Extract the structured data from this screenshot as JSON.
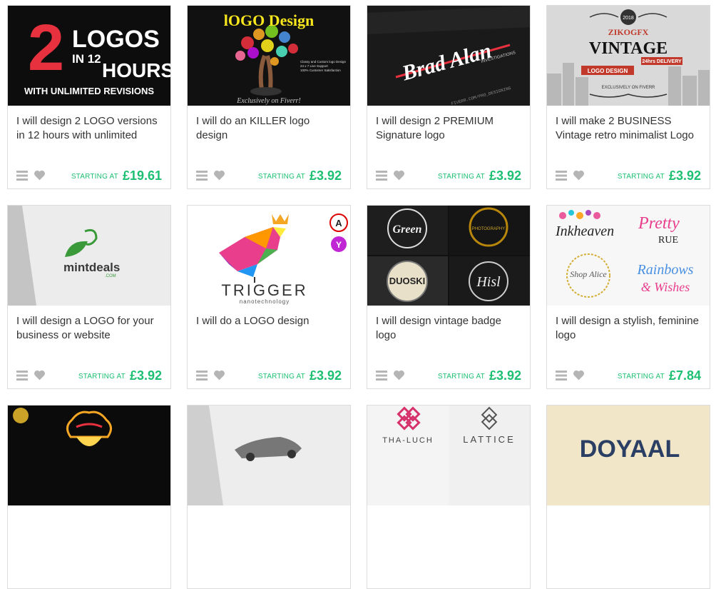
{
  "gigs": [
    {
      "title": "I will design 2 LOGO versions in 12 hours with unlimited",
      "starting": "STARTING AT",
      "price": "£19.61",
      "image": {
        "line1": "2",
        "line2": "LOGOS",
        "line3": "IN 12",
        "line4": "HOURS",
        "line5": "WITH UNLIMITED REVISIONS"
      }
    },
    {
      "title": "I will do an KILLER logo design",
      "starting": "STARTING AT",
      "price": "£3.92",
      "image": {
        "line1": "lOGO Design",
        "line2": "Exclusively on Fiverr!",
        "line3": "Classy and Custom logo Design",
        "line4": "24 x 7 Live Support",
        "line5": "100% Customer Satisfaction"
      }
    },
    {
      "title": "I will design 2 PREMIUM Signature logo",
      "starting": "STARTING AT",
      "price": "£3.92",
      "image": {
        "line1": "Brad Alan",
        "line2": "INVESTIGATIONS",
        "line3": "FIVERR.COM/PRO_DESIGNING"
      }
    },
    {
      "title": "I will make 2 BUSINESS Vintage retro minimalist Logo",
      "starting": "STARTING AT",
      "price": "£3.92",
      "image": {
        "line1": "ZIKOGFX",
        "line2": "VINTAGE",
        "line3": "LOGO DESIGN",
        "line4": "24hrs DELIVERY",
        "line5": "EXCLUSIVELY ON FIVERR",
        "line6": "2018"
      }
    },
    {
      "title": "I will design a LOGO for your business or website",
      "starting": "STARTING AT",
      "price": "£3.92",
      "image": {
        "line1": "mintdeals",
        "line2": ".COM"
      }
    },
    {
      "title": "I will do a LOGO design",
      "starting": "STARTING AT",
      "price": "£3.92",
      "image": {
        "line1": "TRIGGER",
        "line2": "nanotechnology"
      }
    },
    {
      "title": "I will design vintage badge logo",
      "starting": "STARTING AT",
      "price": "£3.92",
      "image": {
        "line1": "Green",
        "line2": "DUOSKI",
        "line3": "Hisl",
        "line4": "PHOTOGRAPHY"
      }
    },
    {
      "title": "I will design a stylish, feminine logo",
      "starting": "STARTING AT",
      "price": "£7.84",
      "image": {
        "line1": "Inkheaven",
        "line2": "Pretty",
        "line3": "RUE",
        "line4": "Shop Alice",
        "line5": "Rainbows",
        "line6": "& Wishes"
      }
    },
    {
      "image": {}
    },
    {
      "image": {}
    },
    {
      "image": {
        "line1": "THA-LUCH",
        "line2": "LATTICE"
      }
    },
    {
      "image": {
        "line1": "DOYAAL"
      }
    }
  ],
  "colors": {
    "accent": "#1dbf73",
    "title": "#333333",
    "icon": "#b5b5b5"
  }
}
